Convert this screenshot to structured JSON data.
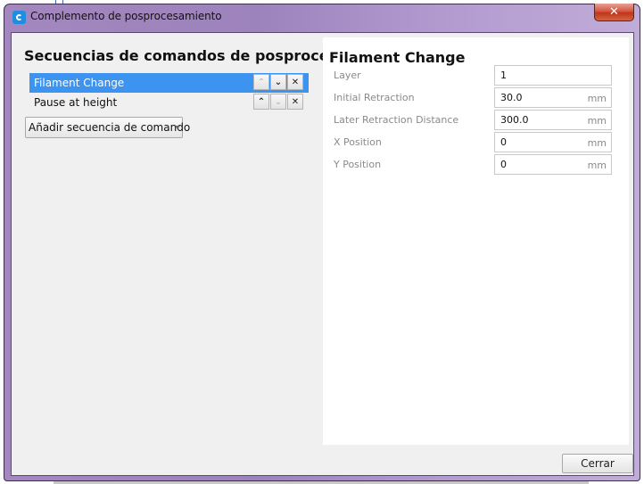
{
  "window": {
    "title": "Complemento de posprocesamiento",
    "app_icon": "cura-logo-icon",
    "close_glyph": "✕"
  },
  "left": {
    "title": "Secuencias de comandos de posproces...",
    "scripts": [
      {
        "label": "Filament Change",
        "selected": true,
        "up_enabled": false,
        "down_enabled": true
      },
      {
        "label": "Pause at height",
        "selected": false,
        "up_enabled": true,
        "down_enabled": false
      }
    ],
    "button_glyphs": {
      "up": "⌃",
      "down": "⌄",
      "remove": "✕"
    },
    "add_button_label": "Añadir secuencia de comando"
  },
  "right": {
    "title": "Filament Change",
    "settings": [
      {
        "label": "Layer",
        "value": "1",
        "unit": ""
      },
      {
        "label": "Initial Retraction",
        "value": "30.0",
        "unit": "mm"
      },
      {
        "label": "Later Retraction Distance",
        "value": "300.0",
        "unit": "mm"
      },
      {
        "label": "X Position",
        "value": "0",
        "unit": "mm"
      },
      {
        "label": "Y Position",
        "value": "0",
        "unit": "mm"
      }
    ]
  },
  "footer": {
    "close_label": "Cerrar"
  },
  "colors": {
    "selection": "#3c93f0",
    "title_bar": "#a387be",
    "close_button": "#c8402a"
  }
}
